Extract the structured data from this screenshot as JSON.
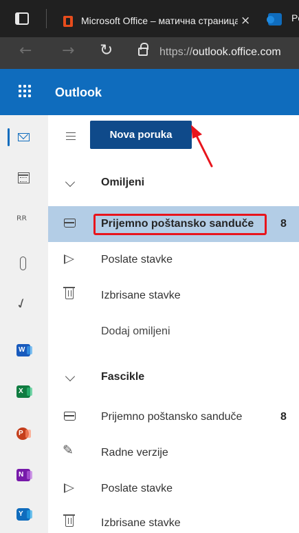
{
  "browser": {
    "active_tab_title": "Microsoft Office – матична страница",
    "second_tab_title": "Po",
    "tab_close_glyph": "×",
    "url_scheme": "https://",
    "url_host": "outlook.office.com"
  },
  "header": {
    "app_name": "Outlook"
  },
  "toolbar": {
    "new_message_label": "Nova poruka"
  },
  "rail": {
    "items": [
      "mail-icon",
      "calendar-icon",
      "people-icon",
      "attachment-icon",
      "todo-icon",
      "word-icon",
      "excel-icon",
      "powerpoint-icon",
      "onenote-icon",
      "yammer-icon"
    ],
    "word_letter": "W",
    "excel_letter": "X",
    "ppt_letter": "P",
    "onenote_letter": "N",
    "yammer_letter": "Y"
  },
  "favorites": {
    "header": "Omiljeni",
    "items": [
      {
        "label": "Prijemno poštansko sanduče",
        "count": "8",
        "icon": "inbox-icon",
        "selected": true
      },
      {
        "label": "Poslate stavke",
        "icon": "send-icon"
      },
      {
        "label": "Izbrisane stavke",
        "icon": "trash-icon"
      }
    ],
    "add_favorite": "Dodaj omiljeni"
  },
  "folders": {
    "header": "Fascikle",
    "items": [
      {
        "label": "Prijemno poštansko sanduče",
        "count": "8",
        "icon": "inbox-icon"
      },
      {
        "label": "Radne verzije",
        "icon": "pencil-icon"
      },
      {
        "label": "Poslate stavke",
        "icon": "send-icon"
      },
      {
        "label": "Izbrisane stavke",
        "icon": "trash-icon"
      }
    ]
  },
  "colors": {
    "brand": "#0f6cbd",
    "selected_row": "#b3cde6",
    "annotation": "#e8141c"
  }
}
